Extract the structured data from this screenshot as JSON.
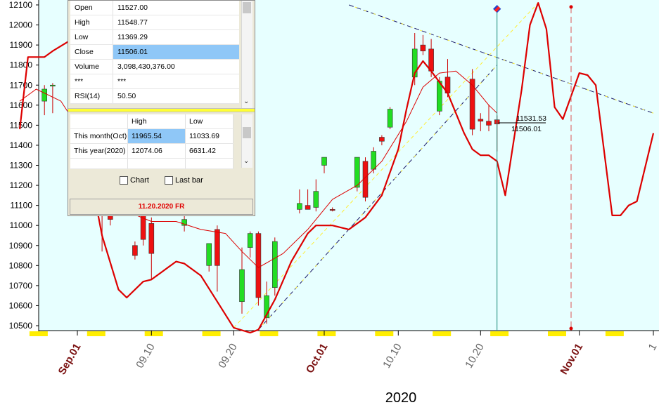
{
  "colors": {
    "plot_bg": "#e7ffff",
    "up_candle": "#22dd22",
    "down_candle": "#ee1111",
    "ma_line": "#dd0000",
    "trend_line": "#1a1a66",
    "support_line": "#ffee33",
    "x_label": "#7a1010",
    "year_label": "#1f29c9",
    "date_red": "#e00000"
  },
  "chart_data": {
    "type": "candlestick",
    "y_range": [
      10480,
      12110
    ],
    "y_ticks": [
      10500,
      10600,
      10700,
      10800,
      10900,
      11000,
      11100,
      11200,
      11300,
      11400,
      11500,
      11600,
      11700,
      11800,
      11900,
      12000,
      12100
    ],
    "x_ticks": [
      {
        "label": "Sep.01",
        "day": 0,
        "bold": true
      },
      {
        "label": "09.10",
        "day": 9,
        "bold": false
      },
      {
        "label": "09.20",
        "day": 19,
        "bold": false
      },
      {
        "label": "Oct.01",
        "day": 30,
        "bold": true
      },
      {
        "label": "10.10",
        "day": 39,
        "bold": false
      },
      {
        "label": "10.20",
        "day": 49,
        "bold": false
      },
      {
        "label": "Nov.01",
        "day": 61,
        "bold": true
      },
      {
        "label": "1",
        "day": 70,
        "bold": false
      }
    ],
    "year_label": "2020",
    "candles": [
      {
        "day": -4,
        "o": 11620,
        "h": 11700,
        "l": 11550,
        "c": 11680
      },
      {
        "day": -3,
        "o": 11695,
        "h": 11710,
        "l": 11560,
        "c": 11700
      },
      {
        "day": 3,
        "o": 11120,
        "h": 11160,
        "l": 10870,
        "c": 11080
      },
      {
        "day": 4,
        "o": 11100,
        "h": 11140,
        "l": 11000,
        "c": 11030
      },
      {
        "day": 7,
        "o": 10900,
        "h": 10920,
        "l": 10830,
        "c": 10850
      },
      {
        "day": 8,
        "o": 11060,
        "h": 11100,
        "l": 10900,
        "c": 10930
      },
      {
        "day": 9,
        "o": 11010,
        "h": 11040,
        "l": 10730,
        "c": 10860
      },
      {
        "day": 13,
        "o": 11000,
        "h": 11050,
        "l": 10970,
        "c": 11030
      },
      {
        "day": 16,
        "o": 10800,
        "h": 10900,
        "l": 10770,
        "c": 10910
      },
      {
        "day": 17,
        "o": 10980,
        "h": 11000,
        "l": 10670,
        "c": 10800
      },
      {
        "day": 20,
        "o": 10620,
        "h": 10890,
        "l": 10560,
        "c": 10780
      },
      {
        "day": 21,
        "o": 10890,
        "h": 10970,
        "l": 10840,
        "c": 10960
      },
      {
        "day": 22,
        "o": 10960,
        "h": 10970,
        "l": 10600,
        "c": 10640
      },
      {
        "day": 23,
        "o": 10540,
        "h": 10720,
        "l": 10510,
        "c": 10650
      },
      {
        "day": 24,
        "o": 10690,
        "h": 10940,
        "l": 10650,
        "c": 10920
      },
      {
        "day": 27,
        "o": 11080,
        "h": 11180,
        "l": 11060,
        "c": 11110
      },
      {
        "day": 28,
        "o": 11100,
        "h": 11180,
        "l": 11080,
        "c": 11080
      },
      {
        "day": 29,
        "o": 11090,
        "h": 11230,
        "l": 11070,
        "c": 11170
      },
      {
        "day": 30,
        "o": 11300,
        "h": 11340,
        "l": 11260,
        "c": 11340
      },
      {
        "day": 31,
        "o": 11080,
        "h": 11090,
        "l": 11070,
        "c": 11075
      },
      {
        "day": 34,
        "o": 11190,
        "h": 11340,
        "l": 11170,
        "c": 11340
      },
      {
        "day": 35,
        "o": 11320,
        "h": 11340,
        "l": 11120,
        "c": 11140
      },
      {
        "day": 36,
        "o": 11280,
        "h": 11390,
        "l": 11260,
        "c": 11370
      },
      {
        "day": 37,
        "o": 11440,
        "h": 11450,
        "l": 11400,
        "c": 11420
      },
      {
        "day": 38,
        "o": 11490,
        "h": 11590,
        "l": 11480,
        "c": 11580
      },
      {
        "day": 41,
        "o": 11740,
        "h": 11960,
        "l": 11700,
        "c": 11880
      },
      {
        "day": 42,
        "o": 11900,
        "h": 11950,
        "l": 11850,
        "c": 11870
      },
      {
        "day": 43,
        "o": 11880,
        "h": 11930,
        "l": 11740,
        "c": 11770
      },
      {
        "day": 44,
        "o": 11570,
        "h": 11740,
        "l": 11550,
        "c": 11720
      },
      {
        "day": 45,
        "o": 11740,
        "h": 11830,
        "l": 11640,
        "c": 11660
      },
      {
        "day": 48,
        "o": 11730,
        "h": 11780,
        "l": 11450,
        "c": 11480
      },
      {
        "day": 49,
        "o": 11530,
        "h": 11560,
        "l": 11470,
        "c": 11520
      },
      {
        "day": 50,
        "o": 11520,
        "h": 11600,
        "l": 11470,
        "c": 11500
      },
      {
        "day": 51,
        "o": 11527,
        "h": 11548.77,
        "l": 11369.29,
        "c": 11506.01
      }
    ],
    "ma_fast": [
      [
        -7,
        11620
      ],
      [
        -5,
        11680
      ],
      [
        -2,
        11620
      ],
      [
        4,
        11240
      ],
      [
        6,
        11070
      ],
      [
        9,
        11020
      ],
      [
        12,
        11020
      ],
      [
        15,
        10980
      ],
      [
        18,
        10960
      ],
      [
        20,
        10870
      ],
      [
        22,
        10790
      ],
      [
        25,
        10860
      ],
      [
        28,
        10980
      ],
      [
        31,
        11130
      ],
      [
        34,
        11200
      ],
      [
        37,
        11320
      ],
      [
        40,
        11520
      ],
      [
        42,
        11690
      ],
      [
        44,
        11760
      ],
      [
        46,
        11770
      ],
      [
        48,
        11700
      ],
      [
        50,
        11600
      ],
      [
        51,
        11560
      ]
    ],
    "ma_slow": [
      [
        -7,
        11480
      ],
      [
        -6,
        11840
      ],
      [
        -4,
        11840
      ],
      [
        -3,
        11870
      ],
      [
        -1,
        11920
      ],
      [
        0,
        11600
      ],
      [
        1,
        11380
      ],
      [
        3,
        10950
      ],
      [
        5,
        10680
      ],
      [
        6,
        10640
      ],
      [
        8,
        10720
      ],
      [
        9,
        10730
      ],
      [
        10,
        10760
      ],
      [
        12,
        10820
      ],
      [
        13,
        10810
      ],
      [
        15,
        10750
      ],
      [
        17,
        10620
      ],
      [
        19,
        10490
      ],
      [
        21,
        10465
      ],
      [
        22,
        10480
      ],
      [
        24,
        10630
      ],
      [
        26,
        10820
      ],
      [
        28,
        10960
      ],
      [
        29,
        11000
      ],
      [
        31,
        11000
      ],
      [
        33,
        10980
      ],
      [
        35,
        11040
      ],
      [
        37,
        11150
      ],
      [
        39,
        11380
      ],
      [
        40,
        11580
      ],
      [
        41,
        11760
      ],
      [
        42,
        11820
      ],
      [
        43,
        11770
      ],
      [
        45,
        11660
      ],
      [
        46,
        11560
      ],
      [
        47,
        11460
      ],
      [
        48,
        11380
      ],
      [
        49,
        11350
      ],
      [
        50,
        11350
      ],
      [
        51,
        11320
      ],
      [
        52,
        11150
      ],
      [
        54,
        11680
      ],
      [
        55,
        12000
      ],
      [
        56,
        12110
      ],
      [
        57,
        11980
      ],
      [
        58,
        11590
      ],
      [
        59,
        11530
      ],
      [
        61,
        11760
      ],
      [
        62,
        11750
      ],
      [
        63,
        11700
      ],
      [
        65,
        11050
      ],
      [
        66,
        11050
      ],
      [
        67,
        11100
      ],
      [
        68,
        11120
      ],
      [
        70,
        11460
      ]
    ],
    "trend_lines": [
      {
        "kind": "resistance",
        "points": [
          [
            33,
            12100
          ],
          [
            70,
            11560
          ]
        ]
      },
      {
        "kind": "support",
        "points": [
          [
            22,
            10480
          ],
          [
            51,
            11800
          ]
        ]
      },
      {
        "kind": "support-ext",
        "points": [
          [
            19,
            10490
          ],
          [
            56,
            12110
          ]
        ]
      }
    ],
    "cursor_day": 51,
    "event_day": 60,
    "price_labels": [
      "11531.53",
      "11506.01"
    ]
  },
  "info_panel": {
    "rows": [
      {
        "key": "Open",
        "value": "11527.00"
      },
      {
        "key": "High",
        "value": "11548.77"
      },
      {
        "key": "Low",
        "value": "11369.29"
      },
      {
        "key": "Close",
        "value": "11506.01"
      },
      {
        "key": "Volume",
        "value": "3,098,430,376.00"
      },
      {
        "key": "***",
        "value": "***"
      },
      {
        "key": "RSI(14)",
        "value": "50.50"
      }
    ],
    "high_low": {
      "col_high": "High",
      "col_low": "Low",
      "rows": [
        {
          "label": "This month(Oct)",
          "high": "11965.54",
          "low": "11033.69"
        },
        {
          "label": "This year(2020)",
          "high": "12074.06",
          "low": "6631.42"
        }
      ]
    },
    "check_chart": "Chart",
    "check_lastbar": "Last bar",
    "date_label": "11.20.2020 FR"
  }
}
